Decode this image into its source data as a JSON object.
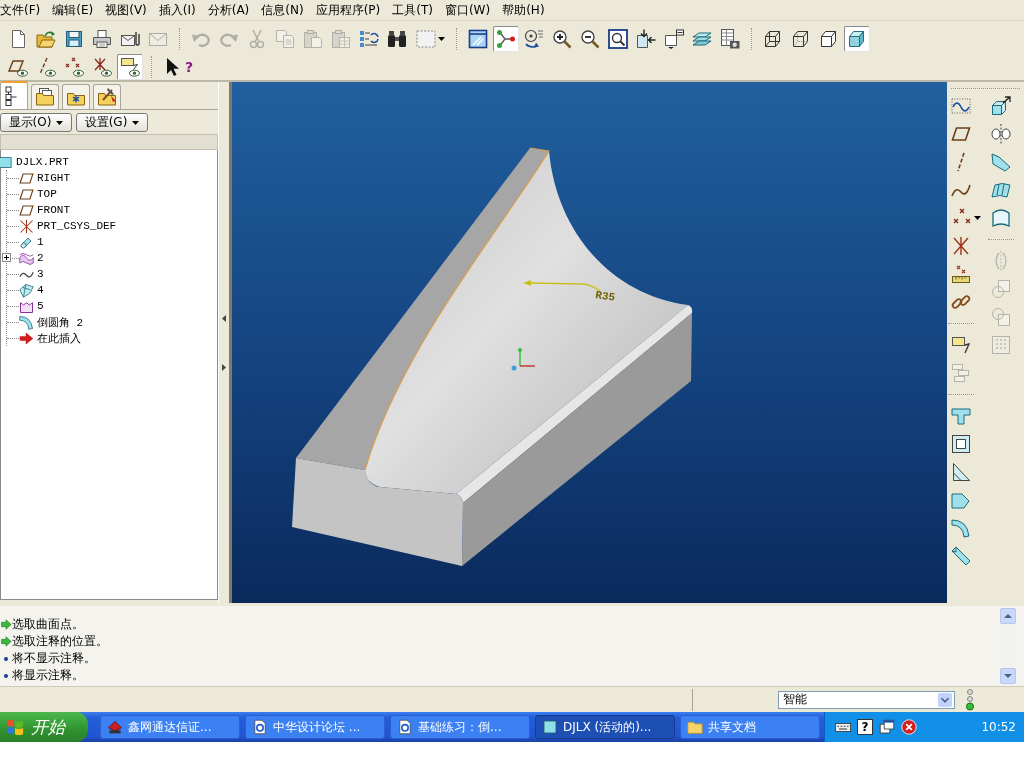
{
  "menu_bar": {
    "items": [
      "文件(F)",
      "编辑(E)",
      "视图(V)",
      "插入(I)",
      "分析(A)",
      "信息(N)",
      "应用程序(P)",
      "工具(T)",
      "窗口(W)",
      "帮助(H)"
    ]
  },
  "toolbar": {
    "rows": [
      {
        "groups": [
          [
            {
              "kind": "new",
              "disabled": false,
              "pressed": false,
              "menu": false
            },
            {
              "kind": "open",
              "disabled": false,
              "pressed": false,
              "menu": false
            },
            {
              "kind": "save",
              "disabled": false,
              "pressed": false,
              "menu": false
            },
            {
              "kind": "print",
              "disabled": false,
              "pressed": false,
              "menu": false
            },
            {
              "kind": "mail",
              "disabled": false,
              "pressed": false,
              "menu": false
            },
            {
              "kind": "mail_plain",
              "disabled": true,
              "pressed": false,
              "menu": false
            }
          ],
          [
            {
              "kind": "undo",
              "disabled": true,
              "pressed": false,
              "menu": false
            },
            {
              "kind": "redo",
              "disabled": true,
              "pressed": false,
              "menu": false
            },
            {
              "kind": "cut",
              "disabled": true,
              "pressed": false,
              "menu": false
            },
            {
              "kind": "copy",
              "disabled": true,
              "pressed": false,
              "menu": false
            },
            {
              "kind": "paste",
              "disabled": true,
              "pressed": false,
              "menu": false
            },
            {
              "kind": "paste_special",
              "disabled": true,
              "pressed": false,
              "menu": false
            },
            {
              "kind": "regen",
              "disabled": false,
              "pressed": false,
              "menu": false
            },
            {
              "kind": "find",
              "disabled": false,
              "pressed": false,
              "menu": false
            },
            {
              "kind": "select_box",
              "disabled": false,
              "pressed": false,
              "menu": true
            }
          ],
          [
            {
              "kind": "repaint",
              "disabled": false,
              "pressed": false,
              "menu": false
            },
            {
              "kind": "spin",
              "disabled": false,
              "pressed": true,
              "menu": false
            },
            {
              "kind": "orient",
              "disabled": false,
              "pressed": false,
              "menu": false
            },
            {
              "kind": "zoom_in",
              "disabled": false,
              "pressed": false,
              "menu": false
            },
            {
              "kind": "zoom_out",
              "disabled": false,
              "pressed": false,
              "menu": false
            },
            {
              "kind": "refit",
              "disabled": false,
              "pressed": false,
              "menu": false
            },
            {
              "kind": "reorient",
              "disabled": false,
              "pressed": false,
              "menu": false
            },
            {
              "kind": "saved_views",
              "disabled": false,
              "pressed": false,
              "menu": false
            },
            {
              "kind": "layers",
              "disabled": false,
              "pressed": false,
              "menu": false
            },
            {
              "kind": "view_manager",
              "disabled": false,
              "pressed": false,
              "menu": false
            }
          ],
          [
            {
              "kind": "wireframe",
              "disabled": false,
              "pressed": false,
              "menu": false
            },
            {
              "kind": "hidden_line",
              "disabled": false,
              "pressed": false,
              "menu": false
            },
            {
              "kind": "no_hidden",
              "disabled": false,
              "pressed": false,
              "menu": false
            },
            {
              "kind": "shaded",
              "disabled": false,
              "pressed": true,
              "menu": false
            }
          ]
        ]
      },
      {
        "groups": [
          [
            {
              "kind": "plane_display",
              "disabled": false,
              "pressed": false,
              "menu": false
            },
            {
              "kind": "axis_display",
              "disabled": false,
              "pressed": false,
              "menu": false
            },
            {
              "kind": "point_display",
              "disabled": false,
              "pressed": false,
              "menu": false
            },
            {
              "kind": "csys_display",
              "disabled": false,
              "pressed": false,
              "menu": false
            },
            {
              "kind": "note_display",
              "disabled": false,
              "pressed": true,
              "menu": false
            }
          ],
          [
            {
              "kind": "help",
              "glyph": "?",
              "disabled": false,
              "pressed": false,
              "menu": false
            }
          ]
        ]
      }
    ]
  },
  "model_tree_panel": {
    "tabs": [
      {
        "kind": "tree",
        "selected": true
      },
      {
        "kind": "folder_layers",
        "selected": false
      },
      {
        "kind": "folder_star",
        "selected": false
      },
      {
        "kind": "folder_tools",
        "selected": false
      }
    ],
    "buttons": [
      {
        "label": "显示(O)"
      },
      {
        "label": "设置(G)"
      }
    ],
    "tree": {
      "label": "DJLX.PRT",
      "kind": "part",
      "children": [
        {
          "label": "RIGHT",
          "kind": "plane",
          "expandable": false
        },
        {
          "label": "TOP",
          "kind": "plane",
          "expandable": false
        },
        {
          "label": "FRONT",
          "kind": "plane",
          "expandable": false
        },
        {
          "label": "PRT_CSYS_DEF",
          "kind": "csys",
          "expandable": false
        },
        {
          "label": "1",
          "kind": "cylinder",
          "expandable": false
        },
        {
          "label": "2",
          "kind": "wave_surface",
          "expandable": true
        },
        {
          "label": "3",
          "kind": "curve",
          "expandable": false
        },
        {
          "label": "4",
          "kind": "surface",
          "expandable": false
        },
        {
          "label": "5",
          "kind": "box_surface",
          "expandable": false
        },
        {
          "label": "倒圆角 2",
          "kind": "round",
          "expandable": false
        },
        {
          "label": "在此插入",
          "kind": "insert",
          "expandable": false
        }
      ]
    }
  },
  "viewport": {
    "dimension": "R35"
  },
  "right_toolbar": {
    "columns": [
      {
        "groups": [
          [
            {
              "kind": "sketch",
              "disabled": false,
              "menu": false
            },
            {
              "kind": "datum_plane",
              "disabled": false,
              "menu": false
            },
            {
              "kind": "datum_axis",
              "disabled": false,
              "menu": false
            },
            {
              "kind": "datum_curve",
              "disabled": false,
              "menu": false
            },
            {
              "kind": "datum_point",
              "disabled": false,
              "menu": true
            },
            {
              "kind": "datum_csys",
              "disabled": false,
              "menu": false
            },
            {
              "kind": "analysis",
              "disabled": false,
              "menu": false
            },
            {
              "kind": "link",
              "disabled": false,
              "menu": false
            }
          ],
          [
            {
              "kind": "note",
              "disabled": false,
              "menu": false
            },
            {
              "kind": "note_tree",
              "disabled": true,
              "menu": false
            }
          ],
          [
            {
              "kind": "hole",
              "disabled": false,
              "menu": false
            },
            {
              "kind": "shell",
              "disabled": false,
              "menu": false
            },
            {
              "kind": "rib",
              "disabled": false,
              "menu": false
            },
            {
              "kind": "draft",
              "disabled": false,
              "menu": false
            },
            {
              "kind": "round",
              "disabled": false,
              "menu": false
            },
            {
              "kind": "chamfer",
              "disabled": false,
              "menu": false
            }
          ]
        ]
      },
      {
        "groups": [
          [
            {
              "kind": "extrude",
              "disabled": false,
              "menu": false
            },
            {
              "kind": "revolve",
              "disabled": false,
              "menu": false
            },
            {
              "kind": "sweep",
              "disabled": false,
              "menu": false
            },
            {
              "kind": "blend",
              "disabled": false,
              "menu": false
            },
            {
              "kind": "boundary",
              "disabled": false,
              "menu": false
            }
          ],
          [
            {
              "kind": "mirror",
              "disabled": true,
              "menu": false
            },
            {
              "kind": "merge",
              "disabled": true,
              "menu": false
            },
            {
              "kind": "intersect",
              "disabled": true,
              "menu": false
            },
            {
              "kind": "pattern",
              "disabled": true,
              "menu": false
            }
          ]
        ]
      }
    ]
  },
  "message_area": {
    "lines": [
      {
        "kind": "prompt",
        "text": "选取曲面点。"
      },
      {
        "kind": "prompt",
        "text": "选取注释的位置。"
      },
      {
        "kind": "info",
        "text": "将不显示注释。"
      },
      {
        "kind": "info",
        "text": "将显示注释。"
      }
    ]
  },
  "status_bar": {
    "filter": "智能"
  },
  "taskbar": {
    "start": "开始",
    "tasks": [
      {
        "kind": "red_app",
        "label": "鑫网通达信证...",
        "selected": false
      },
      {
        "kind": "web_doc",
        "label": "中华设计论坛 ...",
        "selected": false
      },
      {
        "kind": "web_doc",
        "label": "基础练习：倒...",
        "selected": false
      },
      {
        "kind": "proe",
        "label": "DJLX (活动的)...",
        "selected": true
      },
      {
        "kind": "folder",
        "label": "共享文档",
        "selected": false
      }
    ],
    "tray": [
      {
        "kind": "keyboard"
      },
      {
        "kind": "help",
        "glyph": "?"
      },
      {
        "kind": "windows"
      },
      {
        "kind": "alert"
      }
    ],
    "clock": "10:52"
  }
}
